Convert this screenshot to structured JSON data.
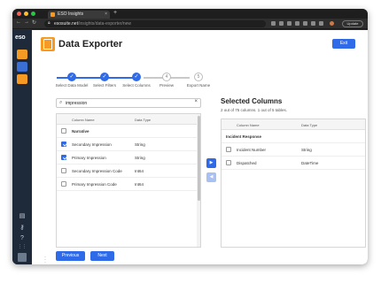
{
  "browser": {
    "tab_title": "ESO Insights",
    "tab_close": "×",
    "new_tab": "+",
    "url_host": "esosuite.net",
    "url_path": "/insights/data-exporter/new",
    "profile": "Update",
    "dot_colors": [
      "#ff5f57",
      "#febc2e",
      "#28c840"
    ]
  },
  "app": {
    "logo": "eso",
    "sidebar_top_icons": [
      "shield-icon",
      "chart-icon",
      "table-icon"
    ],
    "sidebar_bottom_icons": [
      {
        "name": "book-icon",
        "glyph": "▤"
      },
      {
        "name": "key-icon",
        "glyph": "⚷"
      },
      {
        "name": "help-icon",
        "glyph": "?"
      },
      {
        "name": "grid-icon",
        "glyph": "⋮⋮"
      }
    ],
    "accent": "#2f6be8",
    "brand_orange": "#f59a23"
  },
  "header": {
    "title": "Data Exporter",
    "exit_label": "Exit"
  },
  "steps": [
    {
      "label": "Select Data Model",
      "status": "done",
      "marker": "✓"
    },
    {
      "label": "Select Filters",
      "status": "done",
      "marker": "✓"
    },
    {
      "label": "Select Columns",
      "status": "current",
      "marker": "✓"
    },
    {
      "label": "Preview",
      "status": "todo",
      "marker": "4"
    },
    {
      "label": "Export Name",
      "status": "todo",
      "marker": "5"
    }
  ],
  "search": {
    "value": "impression",
    "placeholder": "Search",
    "clear": "×"
  },
  "available": {
    "col_name": "Column Name",
    "col_type": "Data Type",
    "group": "Narrative",
    "rows": [
      {
        "name": "Secondary Impression",
        "type": "String",
        "checked": true
      },
      {
        "name": "Primary Impression",
        "type": "String",
        "checked": true
      },
      {
        "name": "Secondary Impression Code",
        "type": "Int64",
        "checked": false
      },
      {
        "name": "Primary Impression Code",
        "type": "Int64",
        "checked": false
      }
    ]
  },
  "transfer": {
    "add_glyph": "▶",
    "remove_glyph": "◀"
  },
  "selected": {
    "title": "Selected Columns",
    "subtitle": "2 out of 75 columns. 1 out of 5 tables.",
    "col_name": "Column Name",
    "col_type": "Data Type",
    "group": "Incident Response",
    "rows": [
      {
        "name": "Incident Number",
        "type": "String"
      },
      {
        "name": "Dispatched",
        "type": "DateTime"
      }
    ]
  },
  "footer": {
    "previous_label": "Previous",
    "next_label": "Next"
  }
}
